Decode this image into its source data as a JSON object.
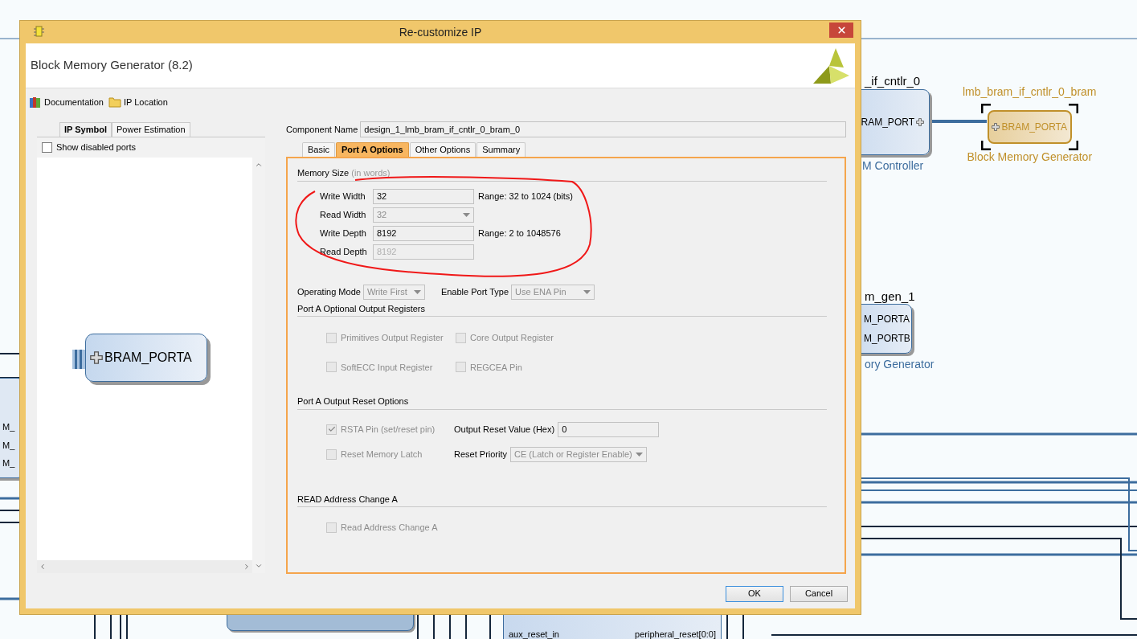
{
  "canvas": {
    "controller": {
      "name": "_if_cntlr_0",
      "port": "RAM_PORT",
      "caption": "M Controller"
    },
    "bram": {
      "name": "lmb_bram_if_cntlr_0_bram",
      "port": "BRAM_PORTA",
      "caption": "Block Memory Generator",
      "selected": true
    },
    "mem_gen": {
      "name": "m_gen_1",
      "ports": [
        "M_PORTA",
        "M_PORTB"
      ],
      "caption": "ory Generator"
    },
    "left_block": {
      "ports": [
        "M_",
        "M_",
        "M_"
      ]
    },
    "reset_block": {
      "inputs": [
        "aux_reset_in"
      ],
      "outputs": [
        "peripheral_reset[0:0]"
      ]
    }
  },
  "dialog": {
    "title": "Re-customize IP",
    "heading": "Block Memory Generator (8.2)",
    "links": [
      "Documentation",
      "IP Location"
    ],
    "left_tabs": [
      {
        "label": "IP Symbol",
        "selected": true
      },
      {
        "label": "Power Estimation",
        "selected": false
      }
    ],
    "show_disabled_ports": {
      "label": "Show disabled ports",
      "checked": false
    },
    "symbol": {
      "port": "BRAM_PORTA"
    },
    "component_name": {
      "label": "Component Name",
      "value": "design_1_lmb_bram_if_cntlr_0_bram_0"
    },
    "tabs": [
      {
        "label": "Basic",
        "selected": false
      },
      {
        "label": "Port A Options",
        "selected": true
      },
      {
        "label": "Other Options",
        "selected": false
      },
      {
        "label": "Summary",
        "selected": false
      }
    ],
    "memory_size": {
      "title": "Memory Size",
      "hint": "(in words)",
      "fields": [
        {
          "label": "Write Width",
          "value": "32",
          "kind": "text",
          "disabled": false,
          "range": "Range: 32 to 1024 (bits)"
        },
        {
          "label": "Read Width",
          "value": "32",
          "kind": "select",
          "disabled": true
        },
        {
          "label": "Write Depth",
          "value": "8192",
          "kind": "text",
          "disabled": false,
          "range": "Range: 2 to 1048576"
        },
        {
          "label": "Read Depth",
          "value": "8192",
          "kind": "text",
          "disabled": true
        }
      ]
    },
    "modes": [
      {
        "label": "Operating Mode",
        "value": "Write First",
        "disabled": true
      },
      {
        "label": "Enable Port Type",
        "value": "Use ENA Pin",
        "disabled": true
      }
    ],
    "output_registers": {
      "title": "Port A Optional Output Registers",
      "options": [
        {
          "label": "Primitives Output Register",
          "checked": false,
          "disabled": true
        },
        {
          "label": "Core Output Register",
          "checked": false,
          "disabled": true
        },
        {
          "label": "SoftECC Input Register",
          "checked": false,
          "disabled": true
        },
        {
          "label": "REGCEA Pin",
          "checked": false,
          "disabled": true
        }
      ]
    },
    "reset_options": {
      "title": "Port A Output Reset Options",
      "rsta": {
        "label": "RSTA Pin (set/reset pin)",
        "checked": true,
        "disabled": true
      },
      "output_reset_value": {
        "label": "Output Reset Value (Hex)",
        "value": "0"
      },
      "reset_memory_latch": {
        "label": "Reset Memory Latch",
        "checked": false,
        "disabled": true
      },
      "reset_priority": {
        "label": "Reset Priority",
        "value": "CE (Latch or Register Enable)",
        "disabled": true
      }
    },
    "read_address_change": {
      "title": "READ Address Change A",
      "option": {
        "label": "Read Address Change A",
        "checked": false,
        "disabled": true
      }
    },
    "buttons": [
      {
        "label": "OK",
        "default": true
      },
      {
        "label": "Cancel",
        "default": false
      }
    ]
  }
}
